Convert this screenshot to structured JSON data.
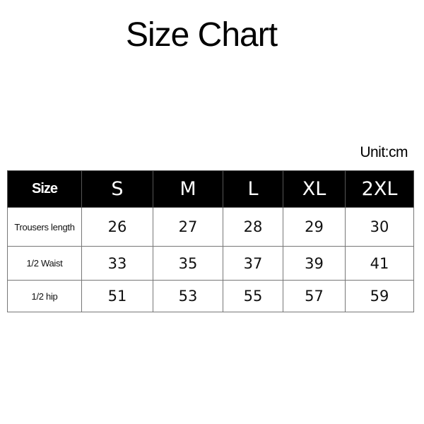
{
  "title": "Size Chart",
  "unit": "Unit:cm",
  "table": {
    "header": [
      "Size",
      "S",
      "M",
      "L",
      "XL",
      "2XL"
    ],
    "rows": [
      {
        "label": "Trousers length",
        "values": [
          "26",
          "27",
          "28",
          "29",
          "30"
        ]
      },
      {
        "label": "1/2 Waist",
        "values": [
          "33",
          "35",
          "37",
          "39",
          "41"
        ]
      },
      {
        "label": "1/2 hip",
        "values": [
          "51",
          "53",
          "55",
          "57",
          "59"
        ]
      }
    ]
  },
  "colors": {
    "header_bg": "#000000",
    "header_text": "#ffffff",
    "border": "#777777"
  }
}
